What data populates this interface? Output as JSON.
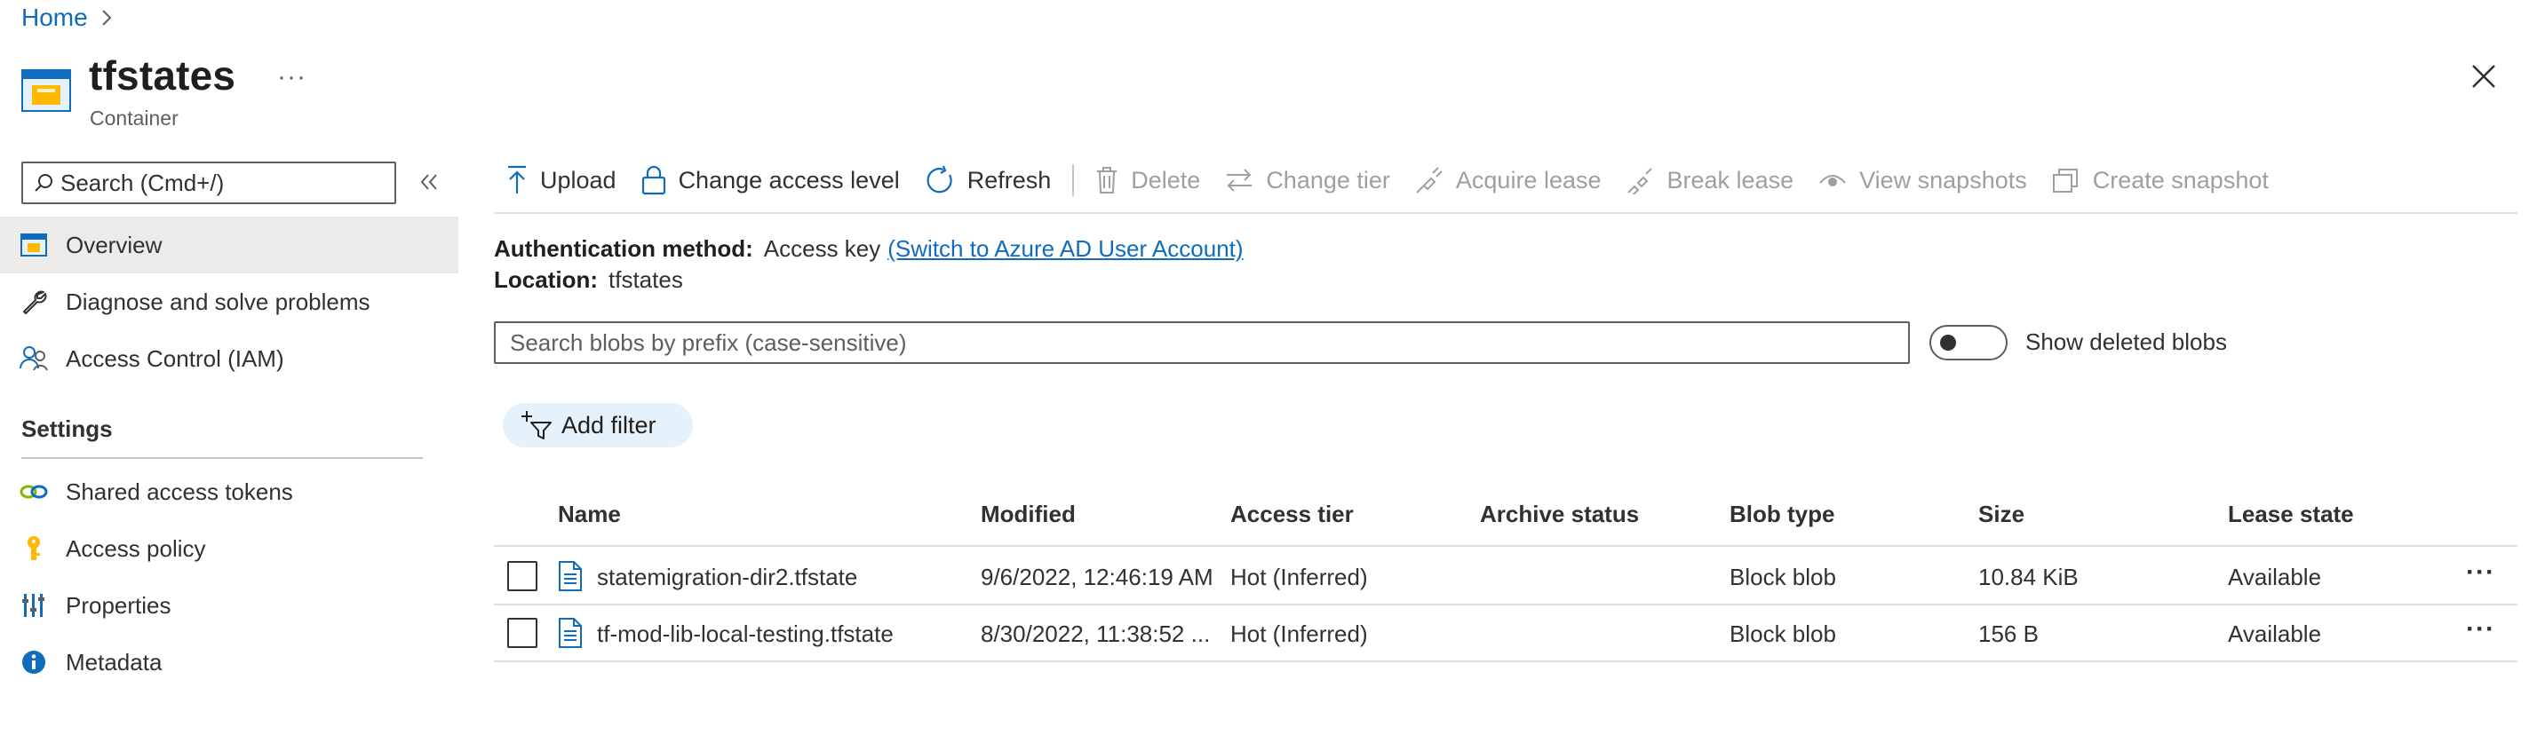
{
  "breadcrumb": {
    "home": "Home",
    "separator": ">"
  },
  "header": {
    "title": "tfstates",
    "subtitle": "Container",
    "more": "···",
    "close": "×"
  },
  "sidebar": {
    "search_placeholder": "Search (Cmd+/)",
    "items": [
      {
        "label": "Overview",
        "icon": "container-icon",
        "active": true
      },
      {
        "label": "Diagnose and solve problems",
        "icon": "wrench-icon"
      },
      {
        "label": "Access Control (IAM)",
        "icon": "people-icon"
      }
    ],
    "settings_label": "Settings",
    "settings_items": [
      {
        "label": "Shared access tokens",
        "icon": "link-icon"
      },
      {
        "label": "Access policy",
        "icon": "key-icon"
      },
      {
        "label": "Properties",
        "icon": "properties-icon"
      },
      {
        "label": "Metadata",
        "icon": "info-icon"
      }
    ]
  },
  "toolbar": {
    "upload": "Upload",
    "change_access_level": "Change access level",
    "refresh": "Refresh",
    "delete": "Delete",
    "change_tier": "Change tier",
    "acquire_lease": "Acquire lease",
    "break_lease": "Break lease",
    "view_snapshots": "View snapshots",
    "create_snapshot": "Create snapshot"
  },
  "info": {
    "auth_label": "Authentication method:",
    "auth_value": "Access key",
    "auth_switch": "(Switch to Azure AD User Account)",
    "location_label": "Location:",
    "location_value": "tfstates"
  },
  "blob_search": {
    "placeholder": "Search blobs by prefix (case-sensitive)"
  },
  "show_deleted": {
    "label": "Show deleted blobs",
    "on": false
  },
  "add_filter": "Add filter",
  "table": {
    "columns": [
      "Name",
      "Modified",
      "Access tier",
      "Archive status",
      "Blob type",
      "Size",
      "Lease state"
    ],
    "rows": [
      {
        "name": "statemigration-dir2.tfstate",
        "modified": "9/6/2022, 12:46:19 AM",
        "tier": "Hot (Inferred)",
        "archive": "",
        "type": "Block blob",
        "size": "10.84 KiB",
        "lease": "Available",
        "more": "···"
      },
      {
        "name": "tf-mod-lib-local-testing.tfstate",
        "modified": "8/30/2022, 11:38:52 ...",
        "tier": "Hot (Inferred)",
        "archive": "",
        "type": "Block blob",
        "size": "156 B",
        "lease": "Available",
        "more": "···"
      }
    ]
  },
  "colors": {
    "accent": "#0f6cbd",
    "active_bg": "#edebe9",
    "filter_bg": "#e5f1fb"
  }
}
